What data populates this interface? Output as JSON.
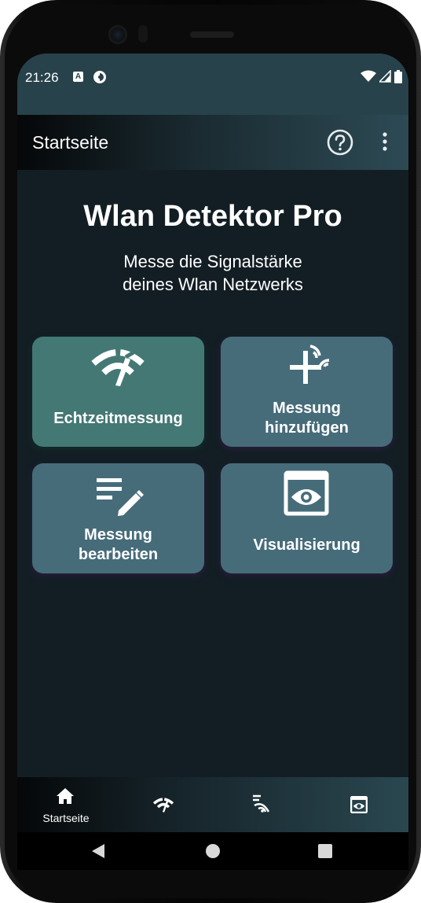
{
  "status_bar": {
    "time": "21:26",
    "notification_icons": [
      "a-box-icon",
      "data-saver-icon"
    ],
    "system_icons": [
      "wifi-icon",
      "cell-signal-icon",
      "battery-icon"
    ]
  },
  "app_bar": {
    "title": "Startseite",
    "actions": [
      "help-icon",
      "more-vert-icon"
    ]
  },
  "hero": {
    "title": "Wlan Detektor Pro",
    "subtitle_line1": "Messe die Signalstärke",
    "subtitle_line2": "deines Wlan Netzwerks"
  },
  "tiles": [
    {
      "label_line1": "Echtzeitmessung",
      "label_line2": "",
      "icon": "wifi-speed-icon",
      "color": "#447875"
    },
    {
      "label_line1": "Messung",
      "label_line2": "hinzufügen",
      "icon": "add-measurement-icon",
      "color": "#466c7a"
    },
    {
      "label_line1": "Messung",
      "label_line2": "bearbeiten",
      "icon": "edit-list-icon",
      "color": "#466c7a"
    },
    {
      "label_line1": "Visualisierung",
      "label_line2": "",
      "icon": "eye-frame-icon",
      "color": "#466c7a"
    }
  ],
  "bottom_nav": {
    "items": [
      {
        "label": "Startseite",
        "icon": "home-icon",
        "selected": true
      },
      {
        "label": "",
        "icon": "wifi-speed-icon",
        "selected": false
      },
      {
        "label": "",
        "icon": "signal-waves-icon",
        "selected": false
      },
      {
        "label": "",
        "icon": "eye-frame-icon",
        "selected": false
      }
    ]
  },
  "system_nav": [
    "back-icon",
    "home-circle-icon",
    "recents-icon"
  ],
  "colors": {
    "background": "#131e24",
    "status_bar": "#27424a",
    "tile_green": "#447875",
    "tile_blue": "#466c7a"
  }
}
